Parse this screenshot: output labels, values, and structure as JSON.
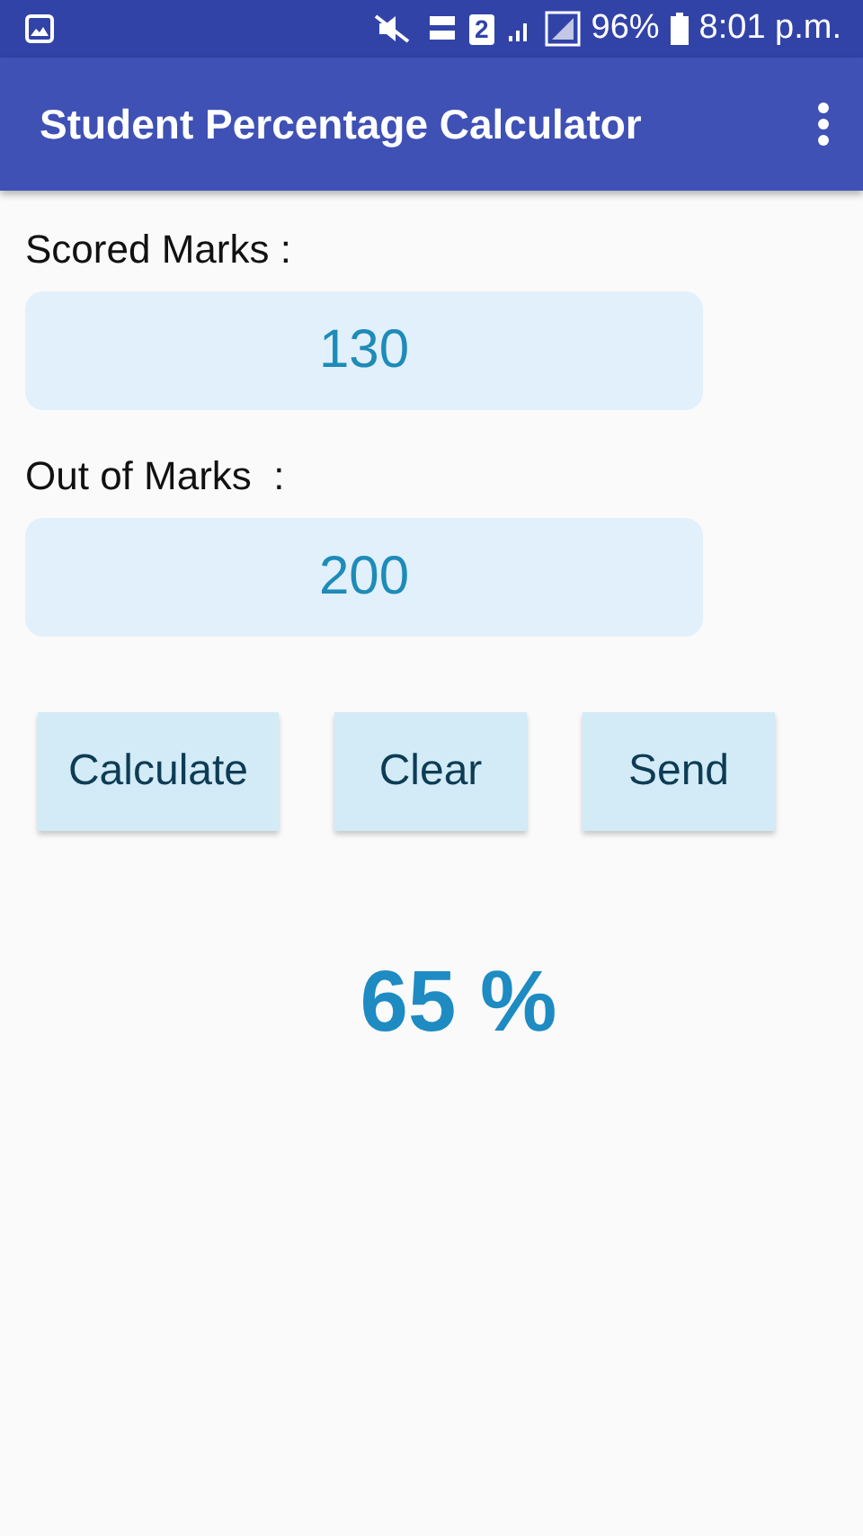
{
  "status_bar": {
    "sim": "2",
    "battery": "96%",
    "time": "8:01 p.m."
  },
  "app_bar": {
    "title": "Student Percentage Calculator"
  },
  "fields": [
    {
      "label": "Scored Marks :",
      "value": "130"
    },
    {
      "label": "Out of Marks  :",
      "value": "200"
    }
  ],
  "buttons": [
    "Calculate",
    "Clear",
    "Send"
  ],
  "result": "65 %"
}
